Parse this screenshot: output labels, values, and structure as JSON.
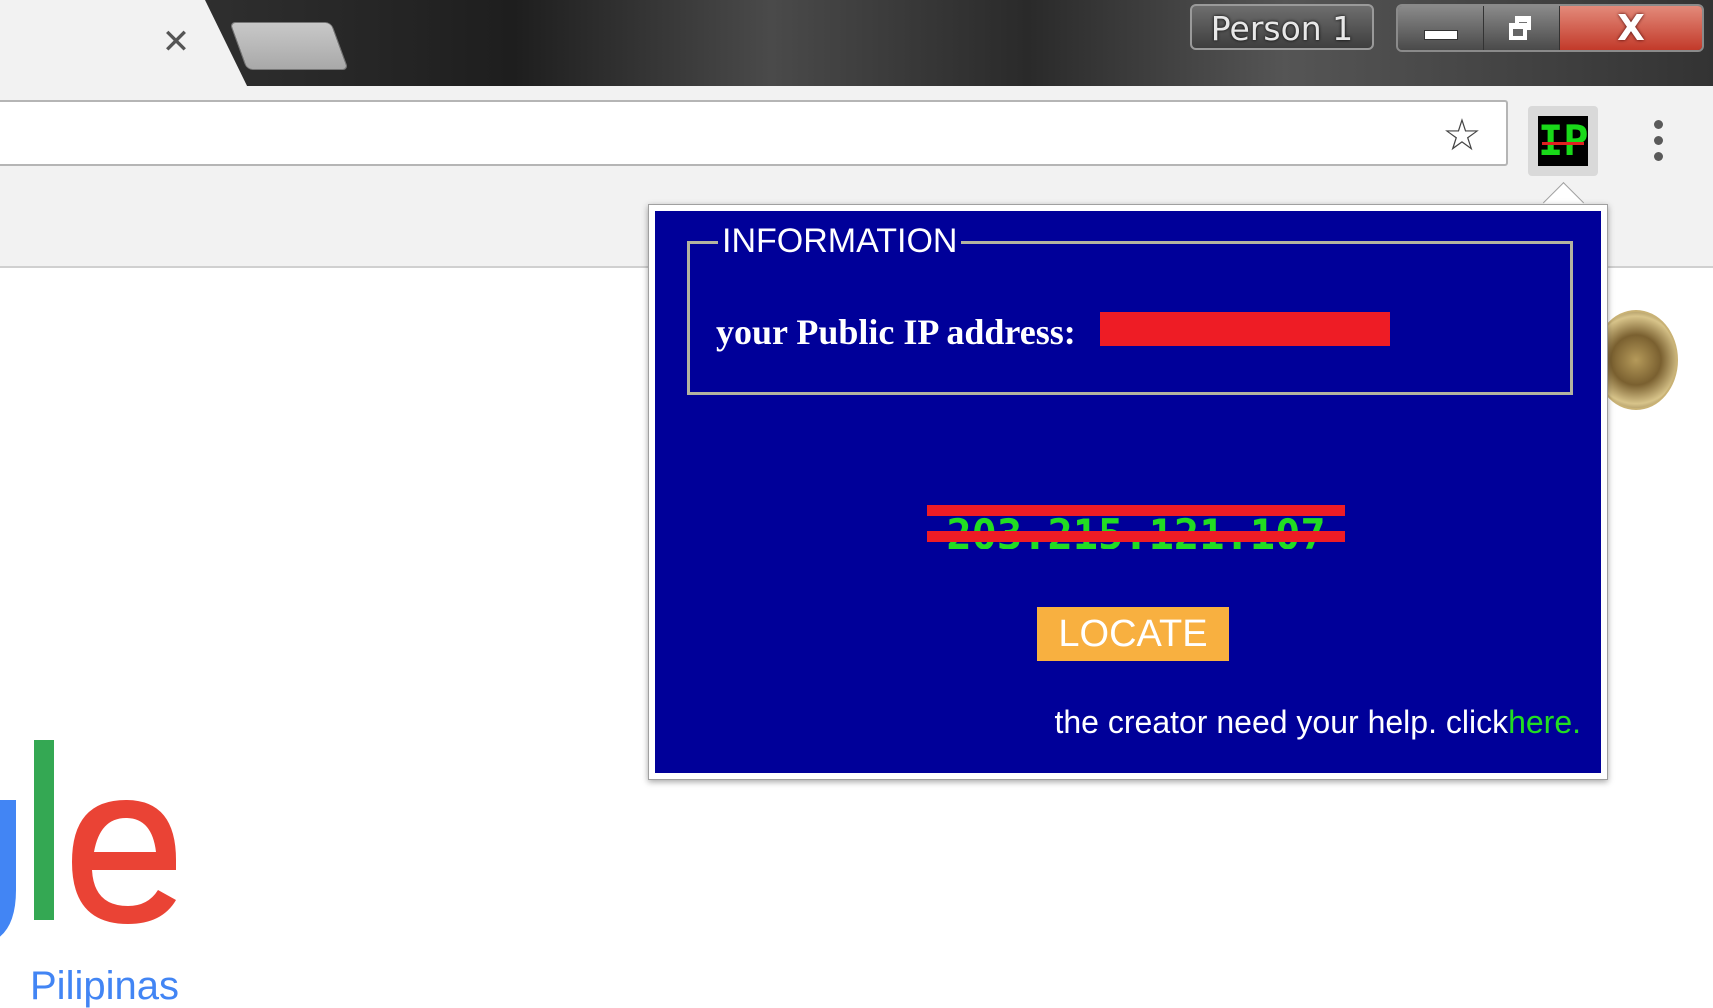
{
  "browser": {
    "tab_close_glyph": "✕",
    "profile_label": "Person 1",
    "close_glyph": "X",
    "bookmark_star_glyph": "☆",
    "extension_icon_text": "IP"
  },
  "page": {
    "logo_fragment": "gle",
    "region_label": "Pilipinas"
  },
  "popup": {
    "fieldset_legend": "INFORMATION",
    "public_ip_label": "your Public IP address:",
    "ip_value": "203.215.121.107",
    "locate_label": "LOCATE",
    "help_text": "the creator need your help. click",
    "help_link": "here."
  },
  "colors": {
    "popup_background": "#000099",
    "redaction": "#ee1c25",
    "ip_text": "#22dd22",
    "locate_button": "#f8b040",
    "google_green": "#34a853",
    "google_red": "#ea4335",
    "google_blue": "#4285f4"
  }
}
